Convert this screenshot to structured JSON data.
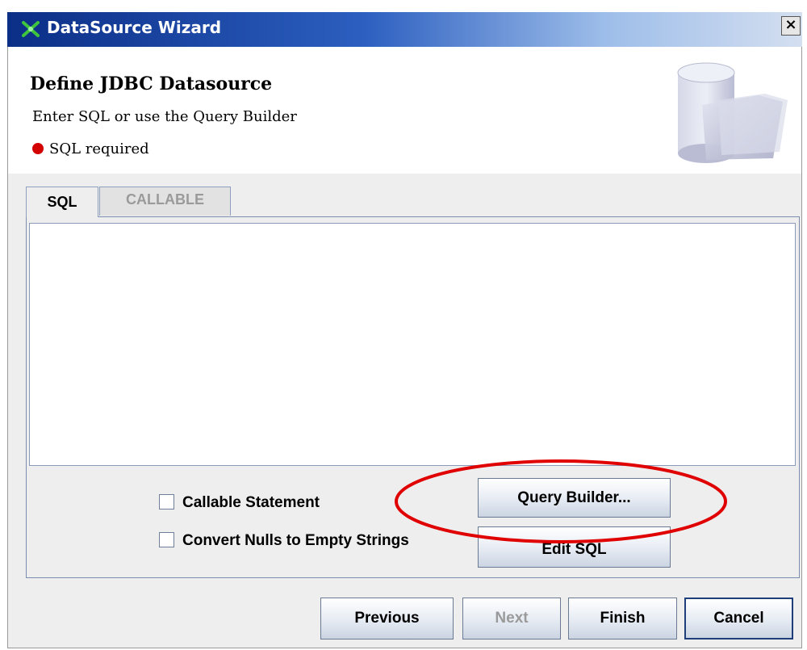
{
  "window": {
    "title": "DataSource Wizard",
    "close_label": "×"
  },
  "header": {
    "title": "Define JDBC Datasource",
    "subtitle": "Enter SQL or use the Query Builder",
    "status_text": "SQL required"
  },
  "tabs": [
    {
      "label": "SQL",
      "selected": true
    },
    {
      "label": "CALLABLE",
      "selected": false
    }
  ],
  "sql_editor": {
    "value": ""
  },
  "options": {
    "callable_statement": {
      "label": "Callable Statement",
      "checked": false
    },
    "convert_nulls": {
      "label": "Convert Nulls to Empty Strings",
      "checked": false
    }
  },
  "panel_buttons": {
    "query_builder": "Query Builder...",
    "edit_sql": "Edit SQL"
  },
  "footer_buttons": {
    "previous": "Previous",
    "next": "Next",
    "finish": "Finish",
    "cancel": "Cancel"
  },
  "colors": {
    "title_bar": "#0b2e86",
    "status_dot": "#d40000",
    "annotation": "#e00000"
  },
  "icons": {
    "app": "wizard-icon",
    "header": "database-folder-icon",
    "status": "required-dot-icon"
  }
}
